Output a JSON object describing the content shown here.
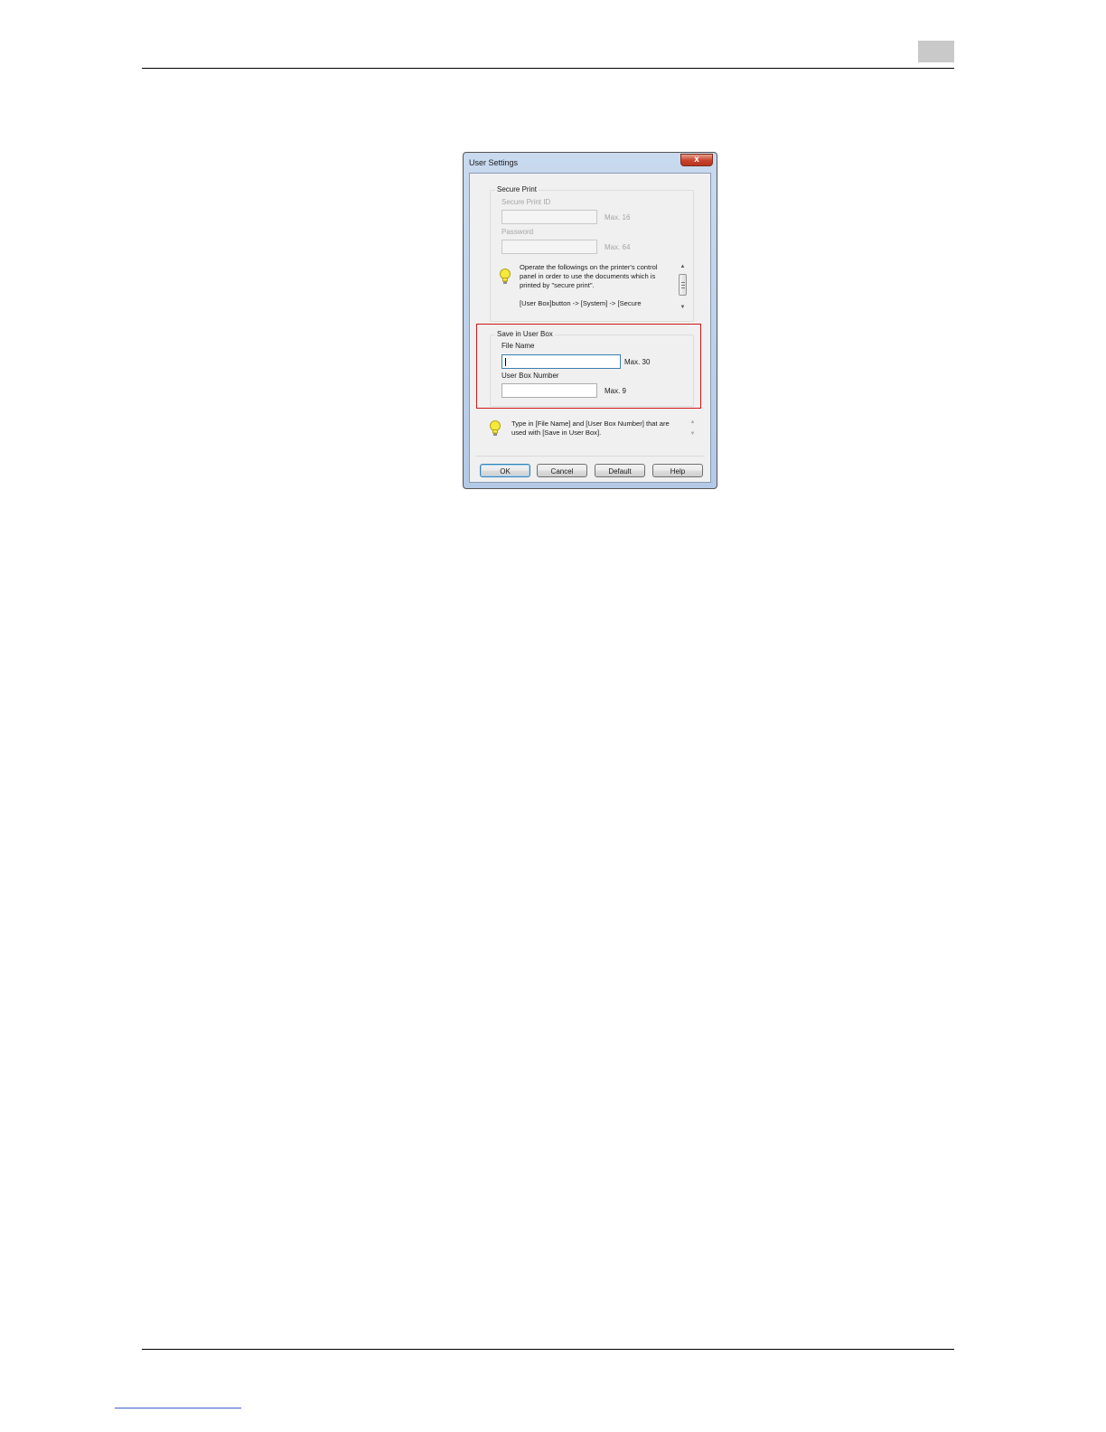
{
  "dialog": {
    "title": "User Settings",
    "close_glyph": "x",
    "secure_print": {
      "group_label": "Secure Print",
      "id_label": "Secure Print ID",
      "id_max": "Max. 16",
      "password_label": "Password",
      "password_max": "Max. 64",
      "hint_line1": "Operate the followings on the printer's control",
      "hint_line2": "panel in order to use the documents which is",
      "hint_line3": "printed by \"secure print\".",
      "hint_line4": "[User Box]button -> [System] -> [Secure"
    },
    "save_in_user_box": {
      "group_label": "Save in User Box",
      "file_name_label": "File Name",
      "file_name_value": "",
      "file_name_max": "Max. 30",
      "box_number_label": "User Box Number",
      "box_number_value": "",
      "box_number_max": "Max. 9"
    },
    "hint_line1": "Type in [File Name] and [User Box Number] that are",
    "hint_line2": "used with [Save in User Box].",
    "buttons": {
      "ok": "OK",
      "cancel": "Cancel",
      "default": "Default",
      "help": "Help"
    }
  },
  "colors": {
    "highlight_frame": "#d01818",
    "hint_bulb": "#f5ea3c"
  }
}
